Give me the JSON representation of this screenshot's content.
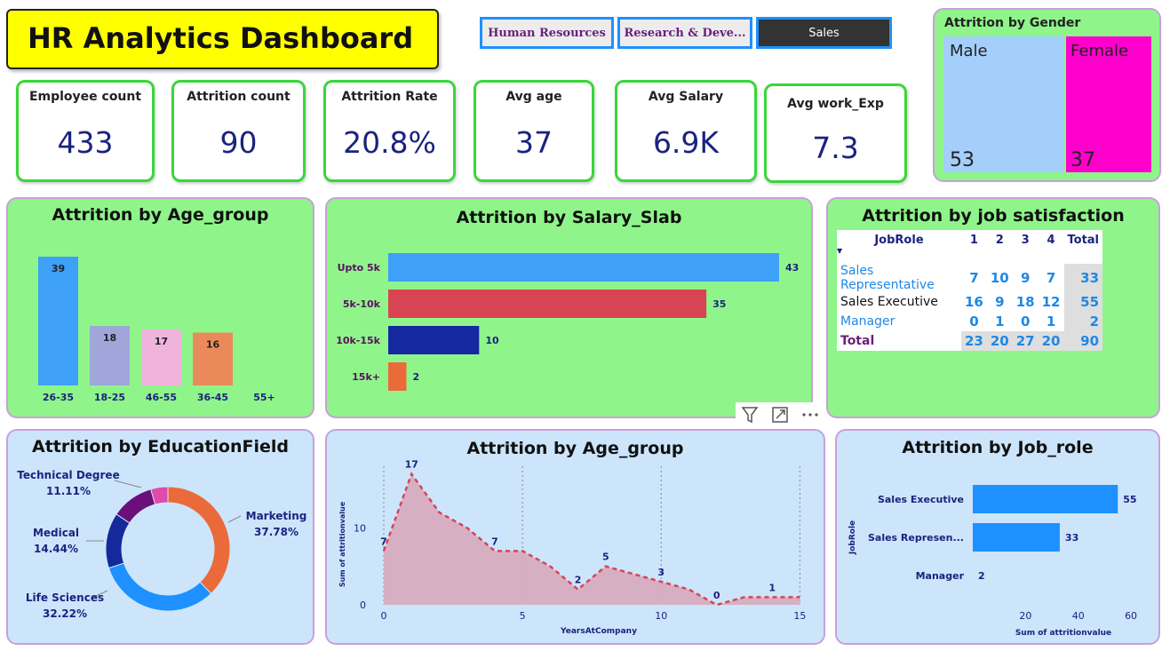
{
  "header": {
    "title": "HR Analytics Dashboard"
  },
  "slicer": {
    "items": [
      "Human Resources",
      "Research & Deve...",
      "Sales"
    ],
    "selected": "Sales"
  },
  "kpis": [
    {
      "label": "Employee count",
      "value": "433"
    },
    {
      "label": "Attrition count",
      "value": "90"
    },
    {
      "label": "Attrition Rate",
      "value": "20.8%"
    },
    {
      "label": "Avg age",
      "value": "37"
    },
    {
      "label": "Avg Salary",
      "value": "6.9K"
    },
    {
      "label": "Avg work_Exp",
      "value": "7.3"
    }
  ],
  "visual_header_icons": [
    "filter-icon",
    "focus-mode-icon",
    "more-options-icon"
  ],
  "colors": {
    "kpi_border": "#3ad63a",
    "green_panel": "#8ff58a",
    "blue_panel": "#cce5fb",
    "accent_blue": "#1e90ff"
  },
  "chart_data": [
    {
      "id": "gender",
      "type": "treemap",
      "title": "Attrition by Gender",
      "categories": [
        "Male",
        "Female"
      ],
      "values": [
        53,
        37
      ],
      "colors": [
        "#a3cffa",
        "#ff00cc"
      ]
    },
    {
      "id": "age_group",
      "type": "bar",
      "title": "Attrition by Age_group",
      "categories": [
        "26-35",
        "18-25",
        "46-55",
        "36-45",
        "55+"
      ],
      "values": [
        39,
        18,
        17,
        16,
        0
      ],
      "colors": [
        "#3fa0f7",
        "#a0a6d9",
        "#f0b4dc",
        "#ea8a5b",
        "#cccccc"
      ]
    },
    {
      "id": "salary_slab",
      "type": "bar",
      "orientation": "horizontal",
      "title": "Attrition by Salary_Slab",
      "categories": [
        "Upto 5k",
        "5k-10k",
        "10k-15k",
        "15k+"
      ],
      "values": [
        43,
        35,
        10,
        2
      ],
      "colors": [
        "#3fa0f7",
        "#d94452",
        "#1428a0",
        "#ea6a3a"
      ]
    },
    {
      "id": "job_satisfaction",
      "type": "table",
      "title": "Attrition by job satisfaction",
      "columns": [
        "JobRole",
        "1",
        "2",
        "3",
        "4",
        "Total"
      ],
      "rows": [
        {
          "role": "Sales Representative",
          "values": [
            "7",
            "10",
            "9",
            "7",
            "33"
          ]
        },
        {
          "role": "Sales Executive",
          "values": [
            "16",
            "9",
            "18",
            "12",
            "55"
          ]
        },
        {
          "role": "Manager",
          "values": [
            "0",
            "1",
            "0",
            "1",
            "2"
          ]
        }
      ],
      "total": {
        "role": "Total",
        "values": [
          "23",
          "20",
          "27",
          "20",
          "90"
        ]
      }
    },
    {
      "id": "education",
      "type": "pie",
      "donut": true,
      "title": "Attrition by EducationField",
      "slices": [
        {
          "name": "Marketing",
          "pct": "37.78%",
          "value": 37.78,
          "color": "#ea6a3a"
        },
        {
          "name": "Life Sciences",
          "pct": "32.22%",
          "value": 32.22,
          "color": "#1e90ff"
        },
        {
          "name": "Medical",
          "pct": "14.44%",
          "value": 14.44,
          "color": "#13299c"
        },
        {
          "name": "Technical Degree",
          "pct": "11.11%",
          "value": 11.11,
          "color": "#6b0f7a"
        },
        {
          "name": "",
          "pct": "",
          "value": 4.45,
          "color": "#e04aa8"
        }
      ]
    },
    {
      "id": "years_area",
      "type": "area",
      "title": "Attrition by Age_group",
      "xlabel": "YearsAtCompany",
      "ylabel": "Sum of attritionvalue",
      "x": [
        0,
        1,
        2,
        3,
        4,
        5,
        6,
        7,
        8,
        9,
        10,
        11,
        12,
        13,
        14,
        15
      ],
      "y": [
        7,
        17,
        12,
        10,
        7,
        7,
        5,
        2,
        5,
        4,
        3,
        2,
        0,
        1,
        1,
        1
      ],
      "point_labels": [
        {
          "x": 0,
          "y": 7,
          "text": "7"
        },
        {
          "x": 1,
          "y": 17,
          "text": "17"
        },
        {
          "x": 4,
          "y": 7,
          "text": "7"
        },
        {
          "x": 7,
          "y": 2,
          "text": "2"
        },
        {
          "x": 8,
          "y": 5,
          "text": "5"
        },
        {
          "x": 10,
          "y": 3,
          "text": "3"
        },
        {
          "x": 12,
          "y": 0,
          "text": "0"
        },
        {
          "x": 14,
          "y": 1,
          "text": "1"
        }
      ],
      "xticks": [
        0,
        5,
        10,
        15
      ],
      "yticks": [
        0,
        10
      ],
      "xlim": [
        0,
        15.5
      ],
      "ylim": [
        0,
        18
      ]
    },
    {
      "id": "job_role",
      "type": "bar",
      "orientation": "horizontal",
      "title": "Attrition by Job_role",
      "categories": [
        "Sales Executive",
        "Sales Represen...",
        "Manager"
      ],
      "values": [
        55,
        33,
        2
      ],
      "xticks": [
        20,
        40,
        60
      ],
      "xlim": [
        0,
        62
      ],
      "xlabel": "Sum of attritionvalue",
      "ylabel": "JobRole",
      "color": "#1e90ff"
    }
  ]
}
